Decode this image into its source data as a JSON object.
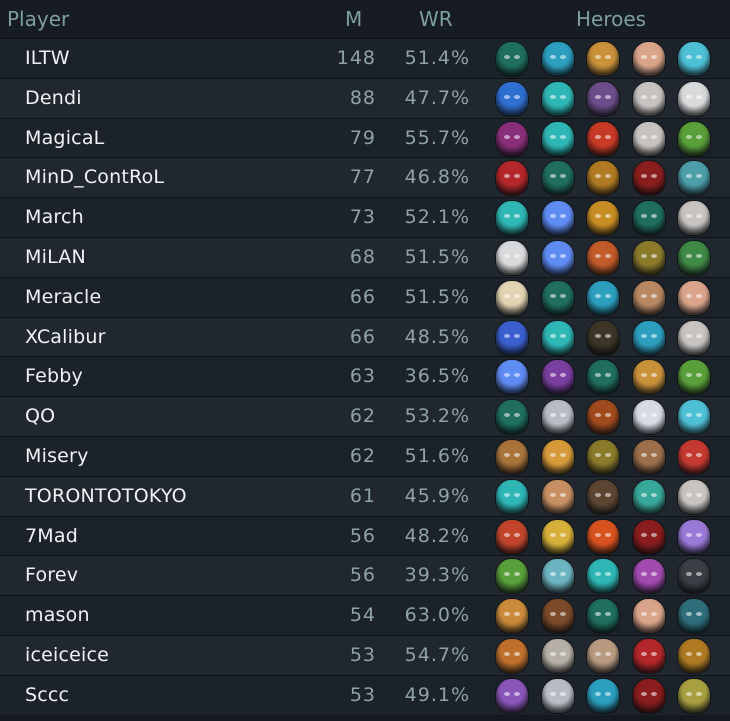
{
  "header": {
    "player": "Player",
    "m": "M",
    "wr": "WR",
    "heroes": "Heroes"
  },
  "rows": [
    {
      "name": "ILTW",
      "m": "148",
      "wr": "51.4%",
      "heroes": [
        {
          "icon": "green-knight-hero-icon",
          "color": "#1f6e5e"
        },
        {
          "icon": "blue-spirit-hero-icon",
          "color": "#2c9fbf"
        },
        {
          "icon": "bearded-king-hero-icon",
          "color": "#c9913a"
        },
        {
          "icon": "old-wizard-hero-icon",
          "color": "#d9a48a"
        },
        {
          "icon": "cyan-beast-hero-icon",
          "color": "#4ec0d6"
        }
      ]
    },
    {
      "name": "Dendi",
      "m": "88",
      "wr": "47.7%",
      "heroes": [
        {
          "icon": "blue-horned-hero-icon",
          "color": "#2f6fd0"
        },
        {
          "icon": "teal-antler-hero-icon",
          "color": "#2fb7b6"
        },
        {
          "icon": "purple-ogre-hero-icon",
          "color": "#6d4d8c"
        },
        {
          "icon": "white-bearded-hero-icon",
          "color": "#c7c3c0"
        },
        {
          "icon": "white-wolf-hero-icon",
          "color": "#d8dadc"
        }
      ]
    },
    {
      "name": "MagicaL",
      "m": "79",
      "wr": "55.7%",
      "heroes": [
        {
          "icon": "masked-assassin-hero-icon",
          "color": "#8a2f7a"
        },
        {
          "icon": "teal-antler-hero-icon",
          "color": "#2fb7b6"
        },
        {
          "icon": "red-samurai-hero-icon",
          "color": "#c73a26"
        },
        {
          "icon": "white-bearded-hero-icon",
          "color": "#c7c3c0"
        },
        {
          "icon": "green-goblin-hero-icon",
          "color": "#5aa03a"
        }
      ]
    },
    {
      "name": "MinD_ContRoL",
      "m": "77",
      "wr": "46.8%",
      "heroes": [
        {
          "icon": "red-demon-hero-icon",
          "color": "#b3262a"
        },
        {
          "icon": "green-knight-hero-icon",
          "color": "#1f6e5e"
        },
        {
          "icon": "golden-beetle-hero-icon",
          "color": "#b07a22"
        },
        {
          "icon": "shadow-fiend-hero-icon",
          "color": "#8a1d1d"
        },
        {
          "icon": "horned-ghost-hero-icon",
          "color": "#4c9ea8"
        }
      ]
    },
    {
      "name": "March",
      "m": "73",
      "wr": "52.1%",
      "heroes": [
        {
          "icon": "teal-antler-hero-icon",
          "color": "#2fb7b6"
        },
        {
          "icon": "blue-wisp-hero-icon",
          "color": "#5f8cf2"
        },
        {
          "icon": "golden-helm-hero-icon",
          "color": "#c78d23"
        },
        {
          "icon": "green-knight-hero-icon",
          "color": "#1f6e5e"
        },
        {
          "icon": "white-bearded-hero-icon",
          "color": "#c7c3c0"
        }
      ]
    },
    {
      "name": "MiLAN",
      "m": "68",
      "wr": "51.5%",
      "heroes": [
        {
          "icon": "white-wolf-hero-icon",
          "color": "#d8dadc"
        },
        {
          "icon": "blue-wisp-hero-icon",
          "color": "#5f8cf2"
        },
        {
          "icon": "red-haired-hero-icon",
          "color": "#c25a2a"
        },
        {
          "icon": "gold-eye-hero-icon",
          "color": "#8a7a2a"
        },
        {
          "icon": "green-hood-hero-icon",
          "color": "#3f8a46"
        }
      ]
    },
    {
      "name": "Meracle",
      "m": "66",
      "wr": "51.5%",
      "heroes": [
        {
          "icon": "bandaged-mummy-hero-icon",
          "color": "#e2d3b2"
        },
        {
          "icon": "green-knight-hero-icon",
          "color": "#1f6e5e"
        },
        {
          "icon": "blue-spirit-hero-icon",
          "color": "#2c9fbf"
        },
        {
          "icon": "dwarf-warrior-hero-icon",
          "color": "#b98863"
        },
        {
          "icon": "old-wizard-hero-icon",
          "color": "#d9a48a"
        }
      ]
    },
    {
      "name": "XCalibur",
      "m": "66",
      "wr": "48.5%",
      "heroes": [
        {
          "icon": "blue-orb-hero-icon",
          "color": "#3a5fcf"
        },
        {
          "icon": "teal-antler-hero-icon",
          "color": "#2fb7b6"
        },
        {
          "icon": "dark-hood-hero-icon",
          "color": "#3d3526"
        },
        {
          "icon": "blue-spirit-hero-icon",
          "color": "#2c9fbf"
        },
        {
          "icon": "white-bearded-hero-icon",
          "color": "#c7c3c0"
        }
      ]
    },
    {
      "name": "Febby",
      "m": "63",
      "wr": "36.5%",
      "heroes": [
        {
          "icon": "blue-wisp-hero-icon",
          "color": "#5f8cf2"
        },
        {
          "icon": "purple-gold-hero-icon",
          "color": "#7a3fa0"
        },
        {
          "icon": "green-knight-hero-icon",
          "color": "#1f6e5e"
        },
        {
          "icon": "bearded-king-hero-icon",
          "color": "#c9913a"
        },
        {
          "icon": "green-goblin-hero-icon",
          "color": "#5aa03a"
        }
      ]
    },
    {
      "name": "QO",
      "m": "62",
      "wr": "53.2%",
      "heroes": [
        {
          "icon": "green-knight-hero-icon",
          "color": "#1f6e5e"
        },
        {
          "icon": "silver-mask-hero-icon",
          "color": "#b8bcc4"
        },
        {
          "icon": "fire-lord-hero-icon",
          "color": "#a04a1e"
        },
        {
          "icon": "pale-maiden-hero-icon",
          "color": "#d6dbe6"
        },
        {
          "icon": "cyan-beast-hero-icon",
          "color": "#4ec0d6"
        }
      ]
    },
    {
      "name": "Misery",
      "m": "62",
      "wr": "51.6%",
      "heroes": [
        {
          "icon": "helmet-sniper-hero-icon",
          "color": "#a9733a"
        },
        {
          "icon": "horned-warrior-hero-icon",
          "color": "#d69a3a"
        },
        {
          "icon": "gold-eye-hero-icon",
          "color": "#8a7a2a"
        },
        {
          "icon": "troll-hero-icon",
          "color": "#9c6f4a"
        },
        {
          "icon": "red-skull-hero-icon",
          "color": "#c53a30"
        }
      ]
    },
    {
      "name": "TORONTOTOKYO",
      "m": "61",
      "wr": "45.9%",
      "heroes": [
        {
          "icon": "teal-antler-hero-icon",
          "color": "#2fb7b6"
        },
        {
          "icon": "young-prince-hero-icon",
          "color": "#c89062"
        },
        {
          "icon": "bearded-rogue-hero-icon",
          "color": "#5c4632"
        },
        {
          "icon": "green-siren-hero-icon",
          "color": "#38a89a"
        },
        {
          "icon": "white-bearded-hero-icon",
          "color": "#c7c3c0"
        }
      ]
    },
    {
      "name": "7Mad",
      "m": "56",
      "wr": "48.2%",
      "heroes": [
        {
          "icon": "red-monkey-hero-icon",
          "color": "#c2452c"
        },
        {
          "icon": "bird-mask-hero-icon",
          "color": "#d6b03a"
        },
        {
          "icon": "flame-demon-hero-icon",
          "color": "#d8521e"
        },
        {
          "icon": "shadow-fiend-hero-icon",
          "color": "#8a1d1d"
        },
        {
          "icon": "purple-ghost-hero-icon",
          "color": "#9a7ad8"
        }
      ]
    },
    {
      "name": "Forev",
      "m": "56",
      "wr": "39.3%",
      "heroes": [
        {
          "icon": "green-goblin-hero-icon",
          "color": "#5aa03a"
        },
        {
          "icon": "frost-ogre-hero-icon",
          "color": "#6cb4c2"
        },
        {
          "icon": "teal-antler-hero-icon",
          "color": "#2fb7b6"
        },
        {
          "icon": "violet-elf-hero-icon",
          "color": "#a34ab0"
        },
        {
          "icon": "dark-horns-hero-icon",
          "color": "#3b3e44"
        }
      ]
    },
    {
      "name": "mason",
      "m": "54",
      "wr": "63.0%",
      "heroes": [
        {
          "icon": "lion-warrior-hero-icon",
          "color": "#c98b3a"
        },
        {
          "icon": "brown-bear-hero-icon",
          "color": "#7a4a2a"
        },
        {
          "icon": "green-knight-hero-icon",
          "color": "#1f6e5e"
        },
        {
          "icon": "old-wizard-hero-icon",
          "color": "#d9a48a"
        },
        {
          "icon": "crimson-stalker-hero-icon",
          "color": "#2e6e7a"
        }
      ]
    },
    {
      "name": "iceiceice",
      "m": "53",
      "wr": "54.7%",
      "heroes": [
        {
          "icon": "goggle-pilot-hero-icon",
          "color": "#c0702c"
        },
        {
          "icon": "bone-knight-hero-icon",
          "color": "#b6b0a6"
        },
        {
          "icon": "pig-warrior-hero-icon",
          "color": "#b89a80"
        },
        {
          "icon": "red-demon-hero-icon",
          "color": "#b3262a"
        },
        {
          "icon": "golden-beetle-hero-icon",
          "color": "#b07a22"
        }
      ]
    },
    {
      "name": "Sccc",
      "m": "53",
      "wr": "49.1%",
      "heroes": [
        {
          "icon": "purple-ogre-hero-icon",
          "color": "#8a55b8"
        },
        {
          "icon": "silver-mask-hero-icon",
          "color": "#b8bcc4"
        },
        {
          "icon": "blue-spirit-hero-icon",
          "color": "#2c9fbf"
        },
        {
          "icon": "shadow-fiend-hero-icon",
          "color": "#8a1d1d"
        },
        {
          "icon": "jester-hero-icon",
          "color": "#a8a040"
        }
      ]
    }
  ]
}
